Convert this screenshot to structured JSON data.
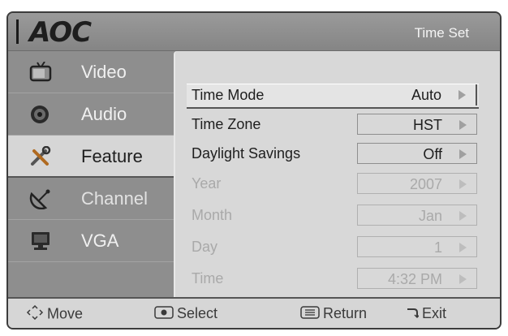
{
  "brand": {
    "logo_text": "AOC"
  },
  "header": {
    "title": "Time Set"
  },
  "sidebar": {
    "items": [
      {
        "label": "Video",
        "icon": "tv-icon",
        "state": "normal"
      },
      {
        "label": "Audio",
        "icon": "speaker-icon",
        "state": "normal"
      },
      {
        "label": "Feature",
        "icon": "tools-icon",
        "state": "selected"
      },
      {
        "label": "Channel",
        "icon": "satellite-dish-icon",
        "state": "dim"
      },
      {
        "label": "VGA",
        "icon": "monitor-icon",
        "state": "normal"
      }
    ]
  },
  "settings": {
    "rows": [
      {
        "label": "Time Mode",
        "value": "Auto",
        "state": "selected"
      },
      {
        "label": "Time Zone",
        "value": "HST",
        "state": "enabled"
      },
      {
        "label": "Daylight Savings",
        "value": "Off",
        "state": "enabled"
      },
      {
        "label": "Year",
        "value": "2007",
        "state": "disabled"
      },
      {
        "label": "Month",
        "value": "Jan",
        "state": "disabled"
      },
      {
        "label": "Day",
        "value": "1",
        "state": "disabled"
      },
      {
        "label": "Time",
        "value": "4:32 PM",
        "state": "disabled"
      }
    ]
  },
  "footer": {
    "move_label": "Move",
    "select_label": "Select",
    "return_label": "Return",
    "exit_label": "Exit"
  },
  "colors": {
    "osd_background": "#8e8e8e",
    "panel_background": "#d8d8d8",
    "text_dark": "#1e1e1e",
    "text_disabled": "#a9a9a9"
  }
}
